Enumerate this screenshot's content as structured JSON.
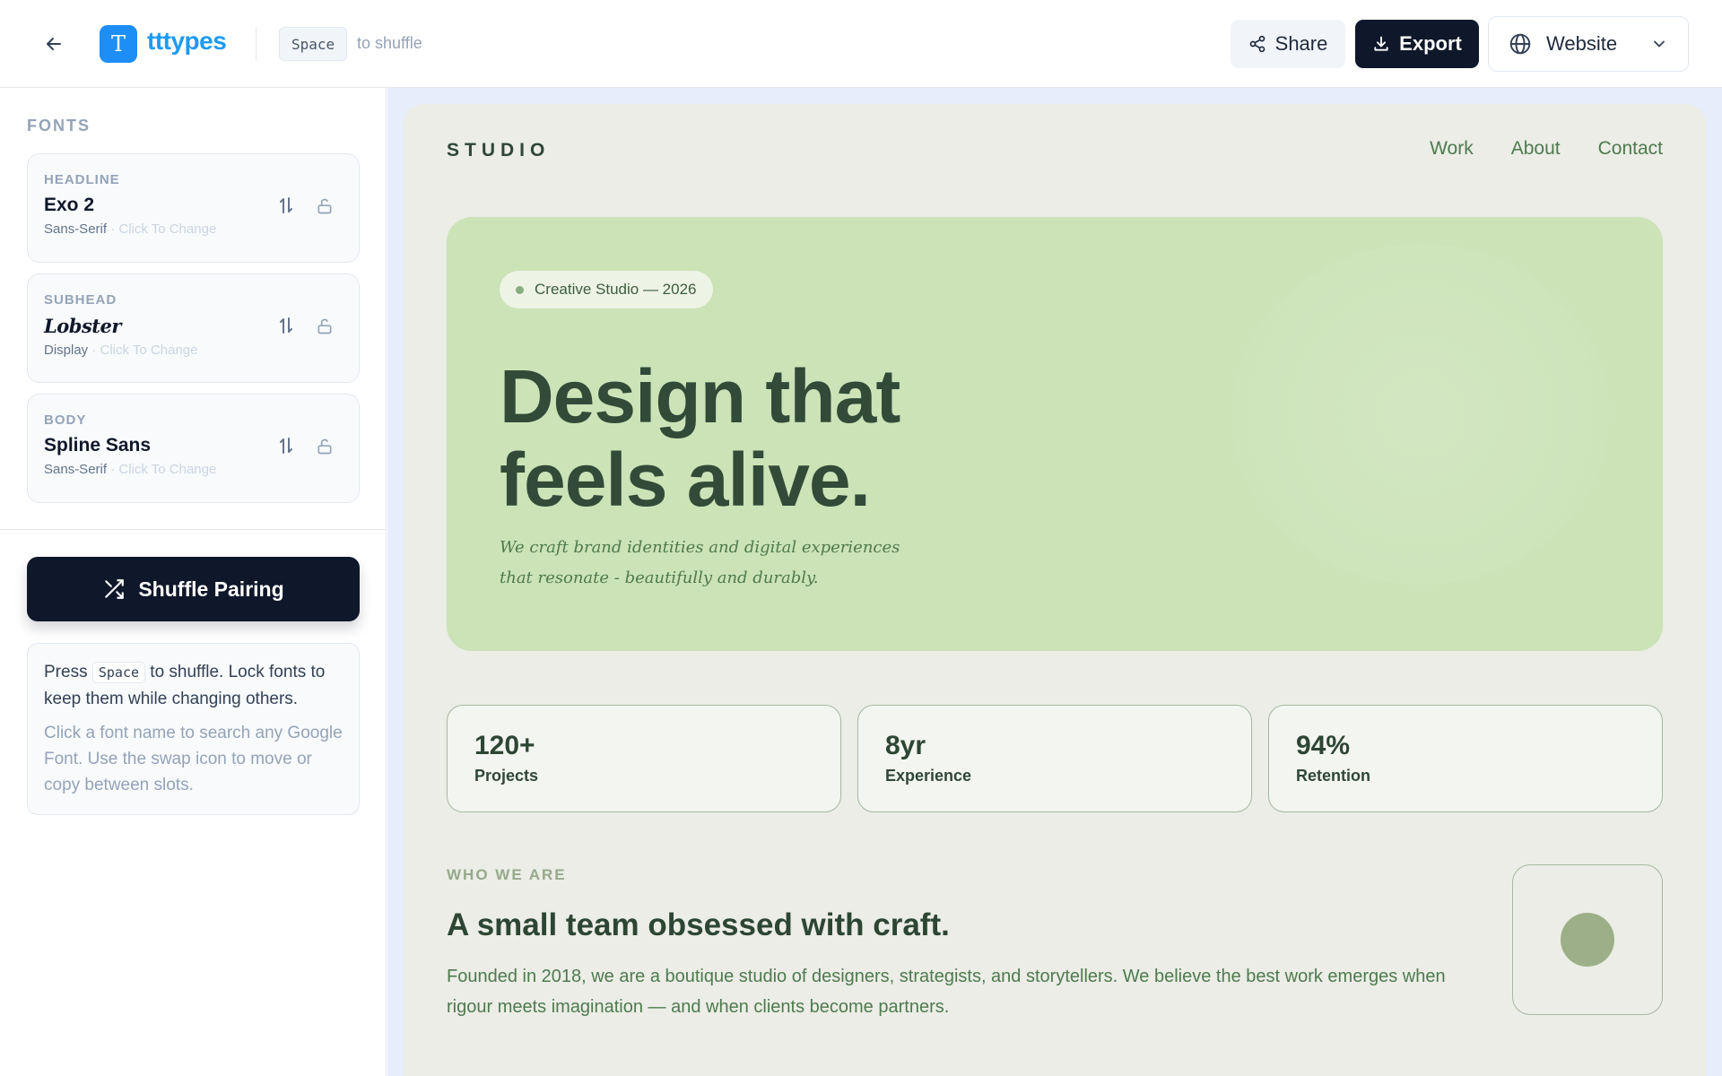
{
  "topbar": {
    "logo_letter": "T",
    "app_name": "tttypes",
    "shortcut_key": "Space",
    "shortcut_hint": "to shuffle",
    "share_label": "Share",
    "export_label": "Export",
    "preview_mode": "Website"
  },
  "sidebar": {
    "heading": "FONTS",
    "fonts": [
      {
        "slot": "HEADLINE",
        "name": "Exo 2",
        "category": "Sans-Serif",
        "action": "· Click To Change"
      },
      {
        "slot": "SUBHEAD",
        "name": "Lobster",
        "category": "Display",
        "action": "· Click To Change"
      },
      {
        "slot": "BODY",
        "name": "Spline Sans",
        "category": "Sans-Serif",
        "action": "· Click To Change"
      }
    ],
    "shuffle_label": "Shuffle Pairing",
    "help": {
      "press": "Press",
      "key": "Space",
      "primary_rest": "to shuffle. Lock fonts to keep them while changing others.",
      "secondary": "Click a font name to search any Google Font. Use the swap icon to move or copy between slots."
    }
  },
  "preview": {
    "brand": "STUDIO",
    "nav": [
      "Work",
      "About",
      "Contact"
    ],
    "hero": {
      "badge": "Creative Studio — 2026",
      "title_line1": "Design that",
      "title_line2": "feels alive.",
      "subtitle": "We craft brand identities and digital experiences that resonate - beautifully and durably."
    },
    "stats": [
      {
        "value": "120+",
        "label": "Projects"
      },
      {
        "value": "8yr",
        "label": "Experience"
      },
      {
        "value": "94%",
        "label": "Retention"
      }
    ],
    "about": {
      "label": "WHO WE ARE",
      "title": "A small team obsessed with craft.",
      "text": "Founded in 2018, we are a boutique studio of designers, strategists, and storytellers. We believe the best work emerges when rigour meets imagination — and when clients become partners."
    }
  },
  "colors": {
    "primary_dark": "#0f172a",
    "logo_blue": "#1d9bf0",
    "hero_green": "#cbe3b7",
    "text_dark_green": "#324b38",
    "accent_green": "#4f7a4f",
    "preview_background": "#ebede6"
  },
  "icons": {
    "back": "arrow-left-icon",
    "share": "share-icon",
    "export": "download-icon",
    "website": "globe-icon",
    "dropdown": "chevron-down-icon",
    "swap": "swap-vertical-icon",
    "lock": "unlock-icon",
    "shuffle": "shuffle-icon"
  }
}
